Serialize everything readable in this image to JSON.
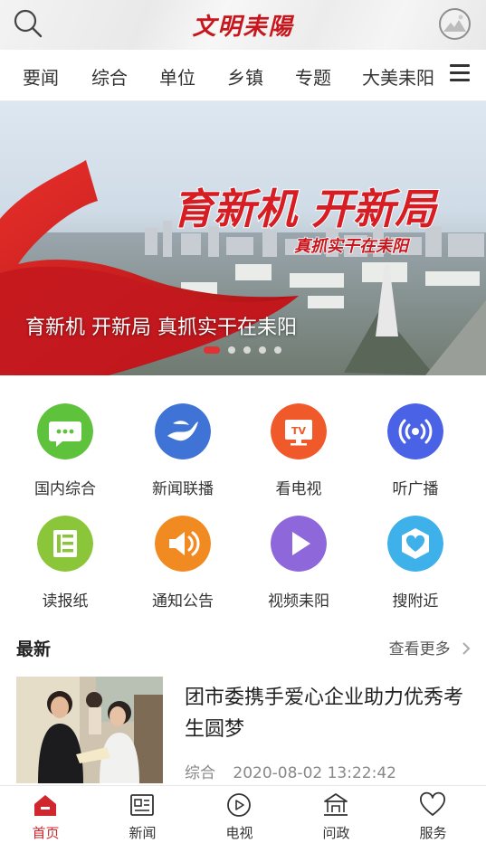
{
  "header": {
    "logo_text": "文明耒陽",
    "brand_color": "#c8161d"
  },
  "tabs": [
    "要闻",
    "综合",
    "单位",
    "乡镇",
    "专题",
    "大美耒阳"
  ],
  "banner": {
    "headline_big": "育新机 开新局",
    "headline_sub": "真抓实干在耒阳",
    "caption": "育新机 开新局 真抓实干在耒阳",
    "slide_count": 5,
    "active_slide": 1
  },
  "grid": [
    {
      "label": "国内综合",
      "icon": "chat-bubble-icon",
      "color": "#5fc23c"
    },
    {
      "label": "新闻联播",
      "icon": "wave-swoosh-icon",
      "color": "#3f74d6"
    },
    {
      "label": "看电视",
      "icon": "tv-icon",
      "color": "#f05a2a"
    },
    {
      "label": "听广播",
      "icon": "radio-broadcast-icon",
      "color": "#4a62e6"
    },
    {
      "label": "读报纸",
      "icon": "newspaper-icon",
      "color": "#8bc63a"
    },
    {
      "label": "通知公告",
      "icon": "speaker-icon",
      "color": "#f28a22"
    },
    {
      "label": "视频耒阳",
      "icon": "play-icon",
      "color": "#8e68da"
    },
    {
      "label": "搜附近",
      "icon": "heart-shield-icon",
      "color": "#3fb1ea"
    }
  ],
  "latest": {
    "title": "最新",
    "more_label": "查看更多"
  },
  "news": [
    {
      "title": "团市委携手爱心企业助力优秀考生圆梦",
      "category": "综合",
      "time": "2020-08-02 13:22:42"
    }
  ],
  "bottom_nav": [
    {
      "label": "首页",
      "icon": "home-icon",
      "active": true
    },
    {
      "label": "新闻",
      "icon": "news-icon",
      "active": false
    },
    {
      "label": "电视",
      "icon": "tv-play-icon",
      "active": false
    },
    {
      "label": "问政",
      "icon": "government-icon",
      "active": false
    },
    {
      "label": "服务",
      "icon": "heart-icon",
      "active": false
    }
  ]
}
